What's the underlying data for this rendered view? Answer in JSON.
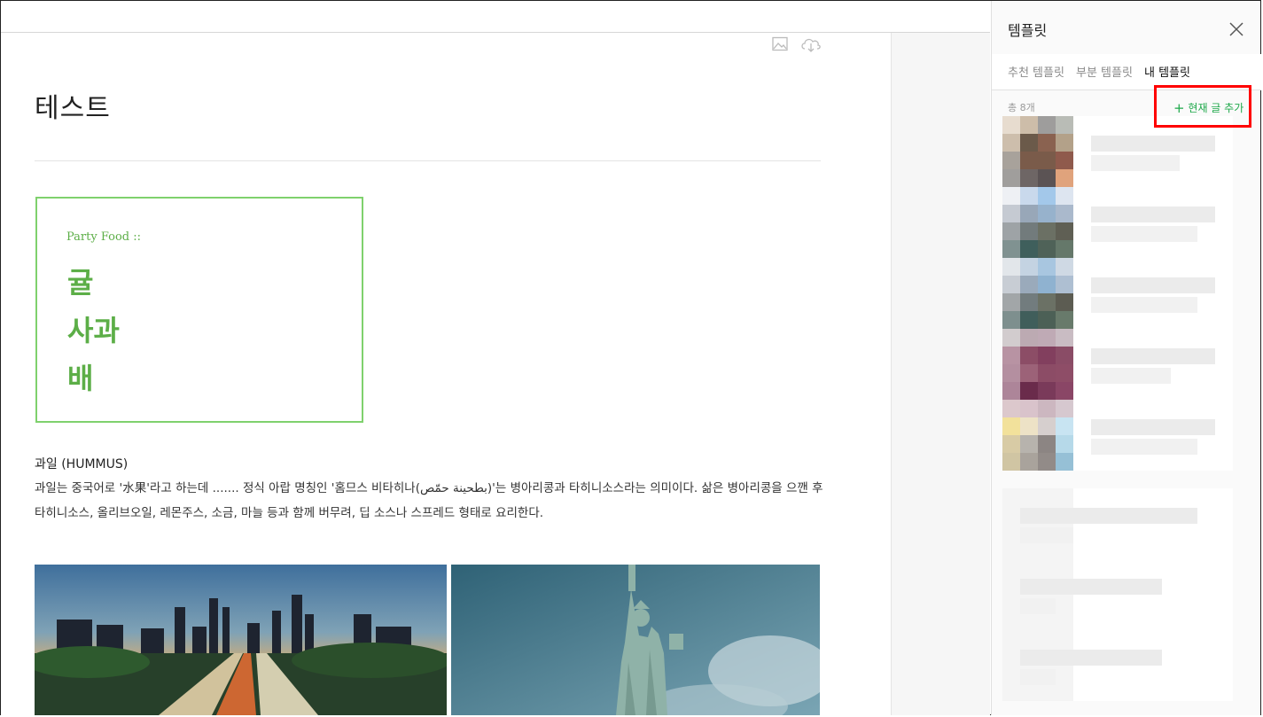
{
  "editor": {
    "title": "테스트",
    "card": {
      "subtitle": "Party Food ::",
      "items": [
        "귤",
        "사과",
        "배"
      ]
    },
    "body_heading": "과일 (HUMMUS)",
    "body_text": "과일는 중국어로 '水果'라고 하는데 ....... 정식 아랍 명칭인 '홈므스 비타히나(بطحينة حمّص)'는 병아리콩과 타히니소스라는 의미이다. 삶은 병아리콩을 으깬 후 타히니소스, 올리브오일, 레몬주스, 소금, 마늘 등과 함께 버무려, 딥 소스나 스프레드 형태로 요리한다.",
    "toolbar_icons": [
      "image-icon",
      "cloud-download-icon"
    ]
  },
  "panel": {
    "title": "템플릿",
    "tabs": [
      "추천 템플릿",
      "부분 템플릿",
      "내 템플릿"
    ],
    "active_tab": "내 템플릿",
    "count": "총 8개",
    "add_label": "현재 글 추가"
  },
  "colors": {
    "accent_green": "#5cae47",
    "add_green": "#1ea84a",
    "highlight_red": "#ff0000"
  }
}
